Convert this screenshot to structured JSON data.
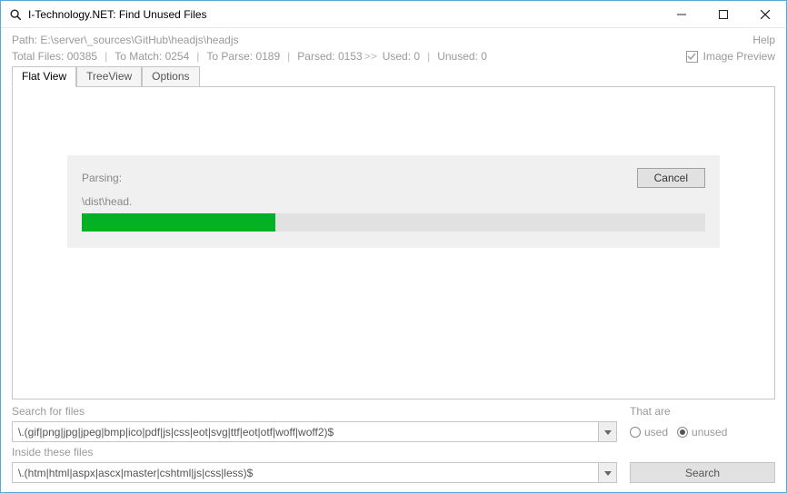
{
  "window": {
    "title": "I-Technology.NET: Find Unused Files"
  },
  "header": {
    "path_label": "Path:",
    "path_value": "E:\\server\\_sources\\GitHub\\headjs\\headjs",
    "help": "Help",
    "stats": {
      "total_files_label": "Total Files:",
      "total_files_value": "00385",
      "to_match_label": "To Match:",
      "to_match_value": "0254",
      "to_parse_label": "To Parse:",
      "to_parse_value": "0189",
      "parsed_label": "Parsed:",
      "parsed_value": "0153",
      "used_label": "Used:",
      "used_value": "0",
      "unused_label": "Unused:",
      "unused_value": "0"
    },
    "image_preview_label": "Image Preview",
    "image_preview_checked": true
  },
  "tabs": {
    "flat": "Flat View",
    "tree": "TreeView",
    "options": "Options",
    "active": "flat"
  },
  "progress": {
    "label": "Parsing:",
    "file": "\\dist\\head.",
    "percent": 31,
    "cancel": "Cancel"
  },
  "search": {
    "search_for_label": "Search for files",
    "search_for_value": "\\.(gif|png|jpg|jpeg|bmp|ico|pdf|js|css|eot|svg|ttf|eot|otf|woff|woff2)$",
    "inside_label": "Inside these files",
    "inside_value": "\\.(htm|html|aspx|ascx|master|cshtml|js|css|less)$",
    "that_are_label": "That are",
    "used_label": "used",
    "unused_label": "unused",
    "selected": "unused",
    "search_button": "Search"
  }
}
